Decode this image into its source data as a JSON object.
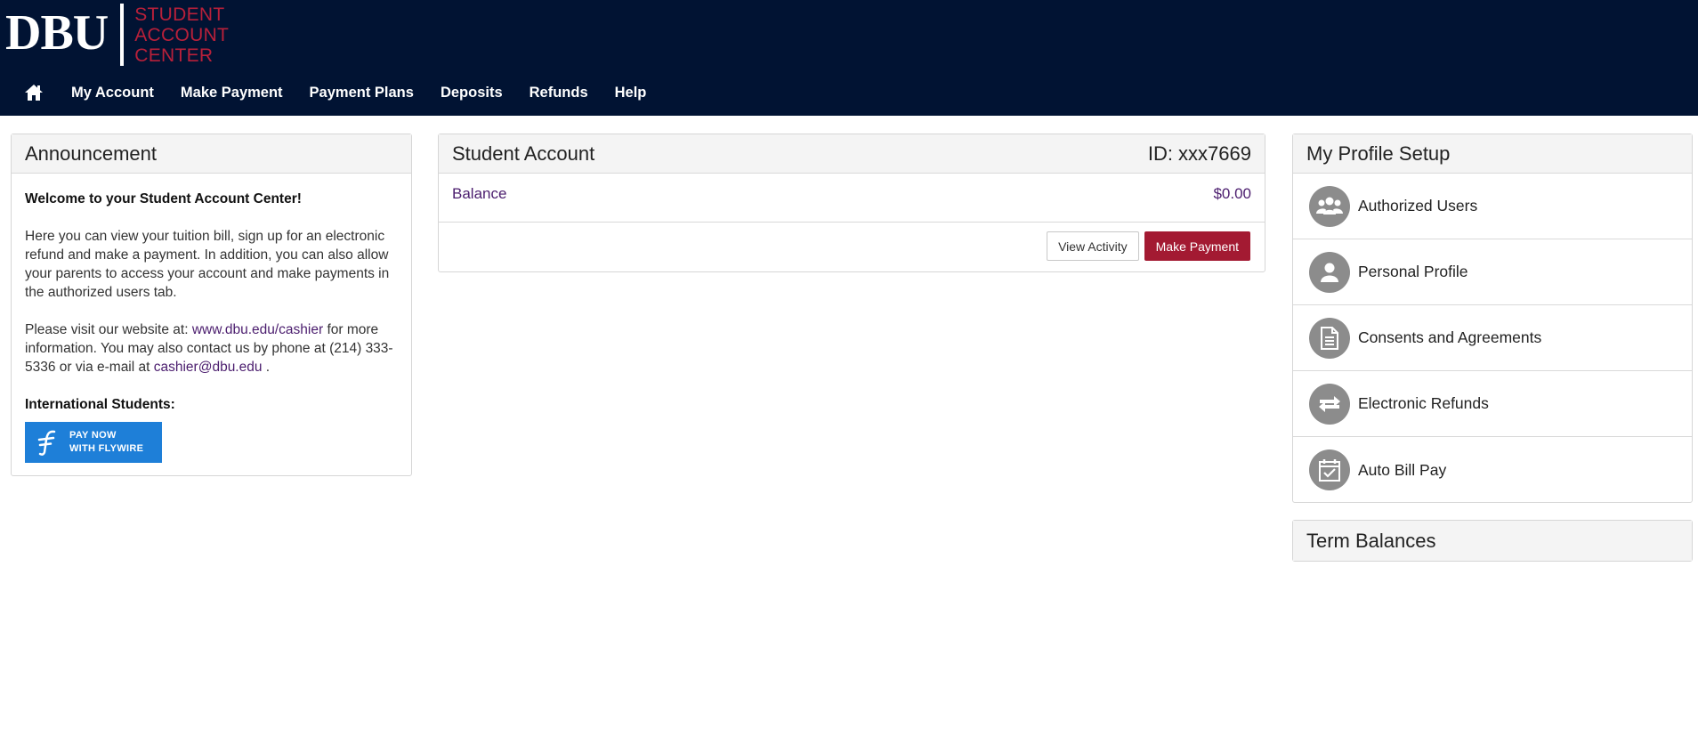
{
  "header": {
    "logo_main": "DBU",
    "logo_sub": [
      "STUDENT",
      "ACCOUNT",
      "CENTER"
    ],
    "nav": [
      "My Account",
      "Make Payment",
      "Payment Plans",
      "Deposits",
      "Refunds",
      "Help"
    ]
  },
  "announcement": {
    "title": "Announcement",
    "welcome": "Welcome to your Student Account Center!",
    "para1": "Here you can view your tuition bill, sign up for an electronic refund and make a payment. In addition, you can also allow your parents to access your account and make payments in the authorized users tab.",
    "para2_pre": "Please visit our website at: ",
    "website_link": "www.dbu.edu/cashier",
    "para2_mid": " for more information. You may also contact us by phone at (214) 333-5336 or via e-mail at ",
    "email_link": "cashier@dbu.edu",
    "para2_post": " .",
    "intl_label": "International Students:",
    "flywire_line1": "PAY NOW",
    "flywire_line2": "WITH FLYWIRE"
  },
  "account": {
    "title": "Student Account",
    "id_label": "ID: xxx7669",
    "balance_label": "Balance",
    "balance_amount": "$0.00",
    "view_activity": "View Activity",
    "make_payment": "Make Payment"
  },
  "profile": {
    "title": "My Profile Setup",
    "items": [
      {
        "label": "Authorized Users",
        "icon": "users-icon"
      },
      {
        "label": "Personal Profile",
        "icon": "user-icon"
      },
      {
        "label": "Consents and Agreements",
        "icon": "document-icon"
      },
      {
        "label": "Electronic Refunds",
        "icon": "refund-arrows-icon"
      },
      {
        "label": "Auto Bill Pay",
        "icon": "calendar-check-icon"
      }
    ]
  },
  "terms": {
    "title": "Term Balances"
  },
  "colors": {
    "header_bg": "#011333",
    "brand_red": "#a31a32",
    "link_purple": "#4b1d6e",
    "flywire_blue": "#1e7fd8",
    "icon_gray": "#8c8c8c"
  }
}
